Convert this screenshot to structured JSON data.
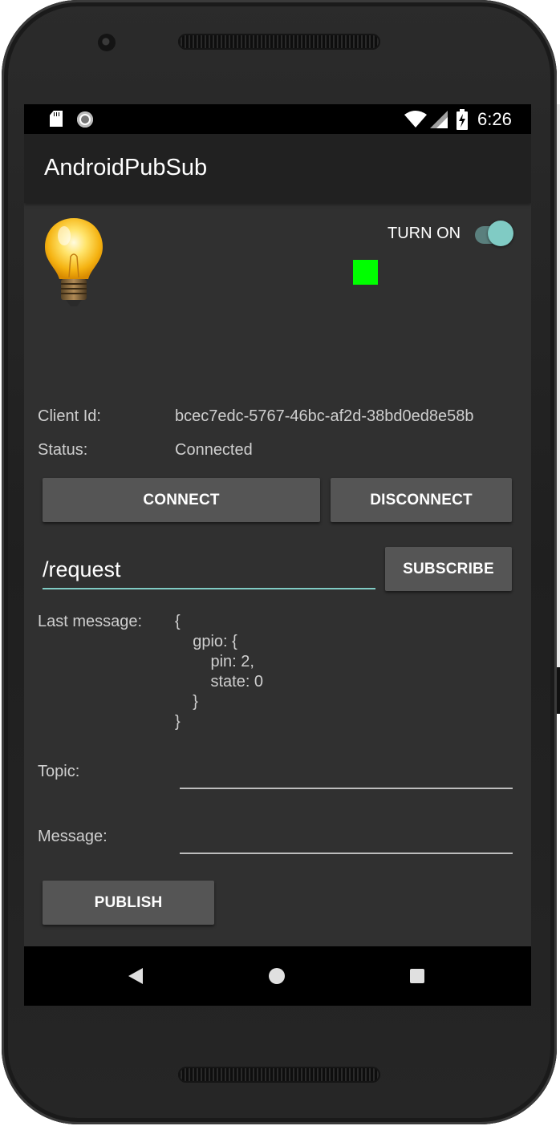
{
  "status_bar": {
    "time": "6:26",
    "icons": [
      "sd-card-icon",
      "sync-icon",
      "wifi-icon",
      "signal-icon",
      "battery-charging-icon"
    ]
  },
  "app": {
    "title": "AndroidPubSub"
  },
  "light": {
    "icon": "lightbulb-icon",
    "toggle_label": "TURN ON",
    "toggle_state": "on",
    "indicator_color": "#00ff00"
  },
  "client": {
    "id_label": "Client Id:",
    "id_value": "bcec7edc-5767-46bc-af2d-38bd0ed8e58b",
    "status_label": "Status:",
    "status_value": "Connected"
  },
  "buttons": {
    "connect": "CONNECT",
    "disconnect": "DISCONNECT",
    "subscribe": "SUBSCRIBE",
    "publish": "PUBLISH"
  },
  "subscribe": {
    "topic_value": "/request"
  },
  "last_message": {
    "label": "Last message:",
    "lines": [
      "{",
      "    gpio: {",
      "        pin: 2,",
      "        state: 0",
      "    }",
      "}"
    ]
  },
  "publish": {
    "topic_label": "Topic:",
    "topic_value": "",
    "message_label": "Message:",
    "message_value": ""
  },
  "nav": {
    "icons": [
      "back-icon",
      "home-icon",
      "recents-icon"
    ]
  },
  "colors": {
    "accent": "#80cbc4",
    "background": "#303030",
    "appbar": "#212121",
    "button": "#555555"
  }
}
